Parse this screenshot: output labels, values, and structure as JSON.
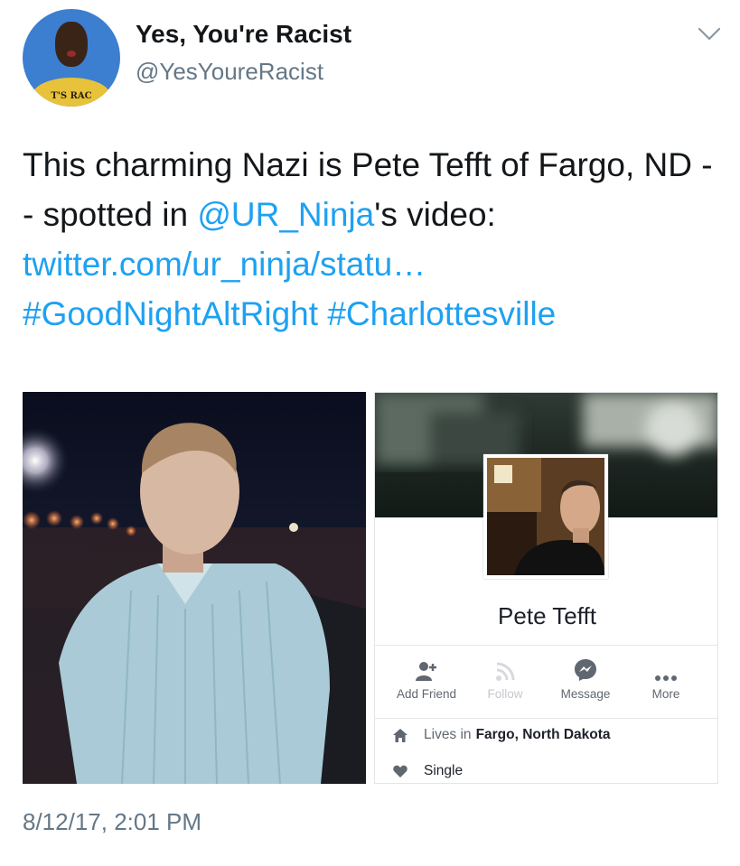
{
  "author": {
    "name": "Yes, You're Racist",
    "handle": "@YesYoureRacist",
    "avatar_icon": "avatar-child-photo",
    "avatar_banner": "T'S RAC"
  },
  "tweet": {
    "text_1": "This charming Nazi is Pete Tefft of Fargo, ND -- spotted in ",
    "mention": "@UR_Ninja",
    "text_2": "'s video: ",
    "link": "twitter.com/ur_ninja/statu…",
    "hashtag_1": "#GoodNightAltRight",
    "hashtag_2": "#Charlottesville"
  },
  "profile_card": {
    "name": "Pete Tefft",
    "actions": [
      {
        "label": "Add Friend",
        "icon": "add-friend-icon",
        "enabled": true
      },
      {
        "label": "Follow",
        "icon": "rss-icon",
        "enabled": false
      },
      {
        "label": "Message",
        "icon": "messenger-icon",
        "enabled": true
      },
      {
        "label": "More",
        "icon": "more-icon",
        "enabled": true
      }
    ],
    "lives_prefix": "Lives in",
    "lives_city": "Fargo, North Dakota",
    "relationship": "Single"
  },
  "timestamp": "8/12/17, 2:01 PM",
  "colors": {
    "link": "#1da1f2",
    "muted": "#657786"
  }
}
